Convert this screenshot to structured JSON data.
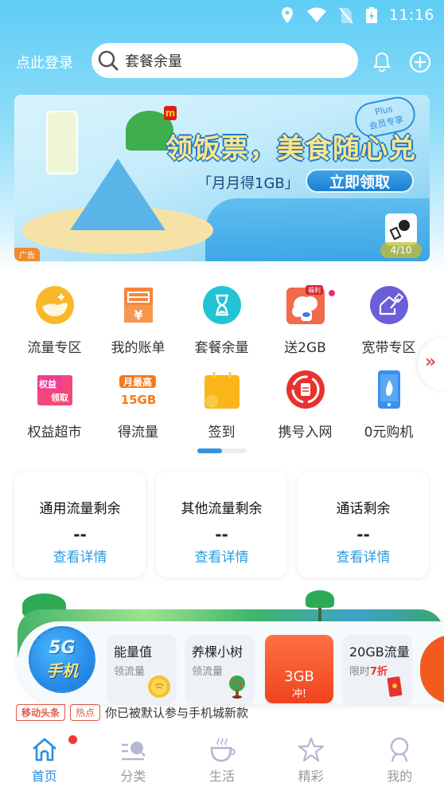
{
  "status_bar": {
    "time": "11:16",
    "icons": [
      "location-icon",
      "wifi-icon",
      "no-sim-icon",
      "battery-charging-icon"
    ]
  },
  "header": {
    "login_label": "点此登录",
    "search_placeholder": "套餐余量",
    "bell_icon": "bell-icon",
    "add_icon": "plus-circle-icon"
  },
  "banner": {
    "ad_tag": "广告",
    "title": "领饭票，美食随心兑",
    "subtitle": "「月月得1GB」",
    "cta_label": "立即领取",
    "badge_top": "Plus",
    "badge_bottom": "会员专享",
    "brand_mark": "m",
    "page_indicator": "4/10"
  },
  "quick_grid": {
    "rows": [
      [
        {
          "label": "流量专区",
          "icon": "data-zone-icon",
          "color": "#f9b82a"
        },
        {
          "label": "我的账单",
          "icon": "bill-icon",
          "color": "#f6853d"
        },
        {
          "label": "套餐余量",
          "icon": "hourglass-icon",
          "color": "#22c4d4"
        },
        {
          "label": "送2GB",
          "icon": "gift-cloud-icon",
          "color": "#f26a4a",
          "badge": "福利",
          "dot": true
        },
        {
          "label": "宽带专区",
          "icon": "broadband-icon",
          "color": "#6a5fd8"
        }
      ],
      [
        {
          "label": "权益超市",
          "icon": "benefits-icon",
          "color": "#f23c6a",
          "text_a": "权益",
          "text_b": "领取"
        },
        {
          "label": "得流量",
          "icon": "monthly-data-icon",
          "color": "#f57a1f",
          "text_a": "月最高",
          "text_b": "15GB"
        },
        {
          "label": "签到",
          "icon": "calendar-icon",
          "color": "#f8b61a"
        },
        {
          "label": "携号入网",
          "icon": "number-transfer-icon",
          "color": "#e8322e"
        },
        {
          "label": "0元购机",
          "icon": "phone-icon",
          "color": "#3a8ff0"
        }
      ]
    ],
    "more_icon": "double-chevron-right-icon",
    "pager_progress": 0.5
  },
  "balance_cards": [
    {
      "title": "通用流量剩余",
      "value": "--",
      "link": "查看详情"
    },
    {
      "title": "其他流量剩余",
      "value": "--",
      "link": "查看详情"
    },
    {
      "title": "通话剩余",
      "value": "--",
      "link": "查看详情"
    }
  ],
  "promo": {
    "badge_line1": "5G",
    "badge_line2": "手机",
    "tiles": [
      {
        "title": "能量值",
        "sub": "领流量",
        "icon": "coin-icon"
      },
      {
        "title": "养棵小树",
        "sub": "领流量",
        "icon": "tree-icon"
      },
      {
        "big": "3GB",
        "small": "冲!"
      },
      {
        "title": "20GB流量",
        "sub_prefix": "限时",
        "sub_highlight": "7折",
        "icon": "red-packet-icon"
      }
    ]
  },
  "news_strip": {
    "tag1": "移动头条",
    "tag2": "热点",
    "text": "你已被默认参与手机城新款"
  },
  "tab_bar": {
    "tabs": [
      {
        "label": "首页",
        "icon": "home-icon",
        "active": true,
        "dot": true
      },
      {
        "label": "分类",
        "icon": "category-search-icon",
        "active": false
      },
      {
        "label": "生活",
        "icon": "coffee-cup-icon",
        "active": false
      },
      {
        "label": "精彩",
        "icon": "star-icon",
        "active": false
      },
      {
        "label": "我的",
        "icon": "user-icon",
        "active": false
      }
    ],
    "active_color": "#2a8fe0",
    "inactive_color": "#999999"
  }
}
